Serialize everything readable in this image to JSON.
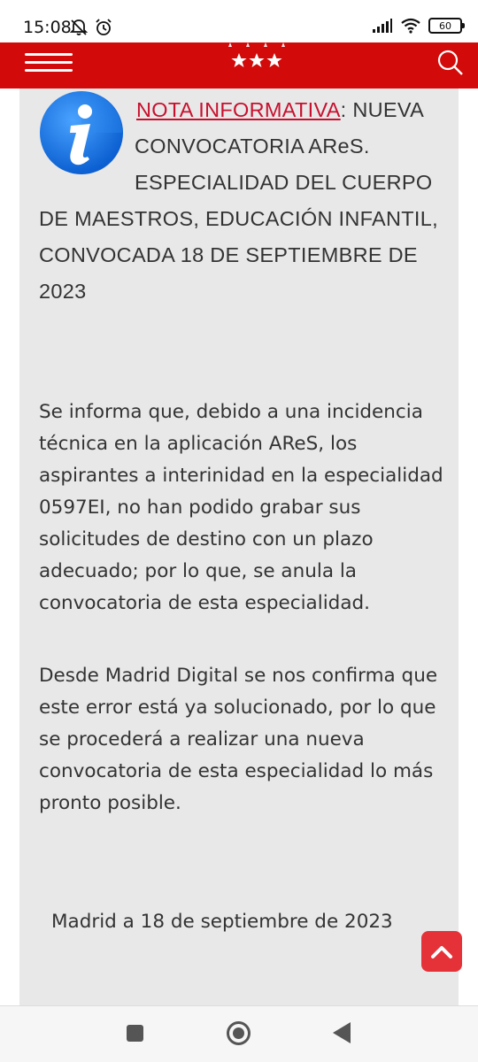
{
  "status_bar": {
    "time": "15:08",
    "battery": "60"
  },
  "header": {
    "brand_color": "#d20a0a"
  },
  "notice": {
    "label": "NOTA INFORMATIVA",
    "label_suffix": ":",
    "title": "NUEVA CONVOCATORIA AReS. ESPECIALIDAD DEL CUERPO DE MAESTROS, EDUCACIÓN INFANTIL, CONVOCADA 18 DE SEPTIEMBRE DE 2023",
    "paragraph_1": "Se informa que, debido a una incidencia técnica en la aplicación AReS, los aspirantes a interinidad en la especialidad 0597EI, no han podido grabar sus solicitudes de destino con un plazo adecuado; por lo que, se anula la convocatoria de esta especialidad.",
    "paragraph_2": "Desde Madrid Digital se nos confirma que este error está ya solucionado, por lo que se procederá a realizar una nueva convocatoria de esta especialidad lo más pronto posible.",
    "closing": "Madrid a 18 de septiembre de 2023"
  },
  "icons": {
    "info": "info-icon",
    "menu": "hamburger-menu-icon",
    "search": "search-icon",
    "scroll_top": "chevron-up-icon"
  }
}
